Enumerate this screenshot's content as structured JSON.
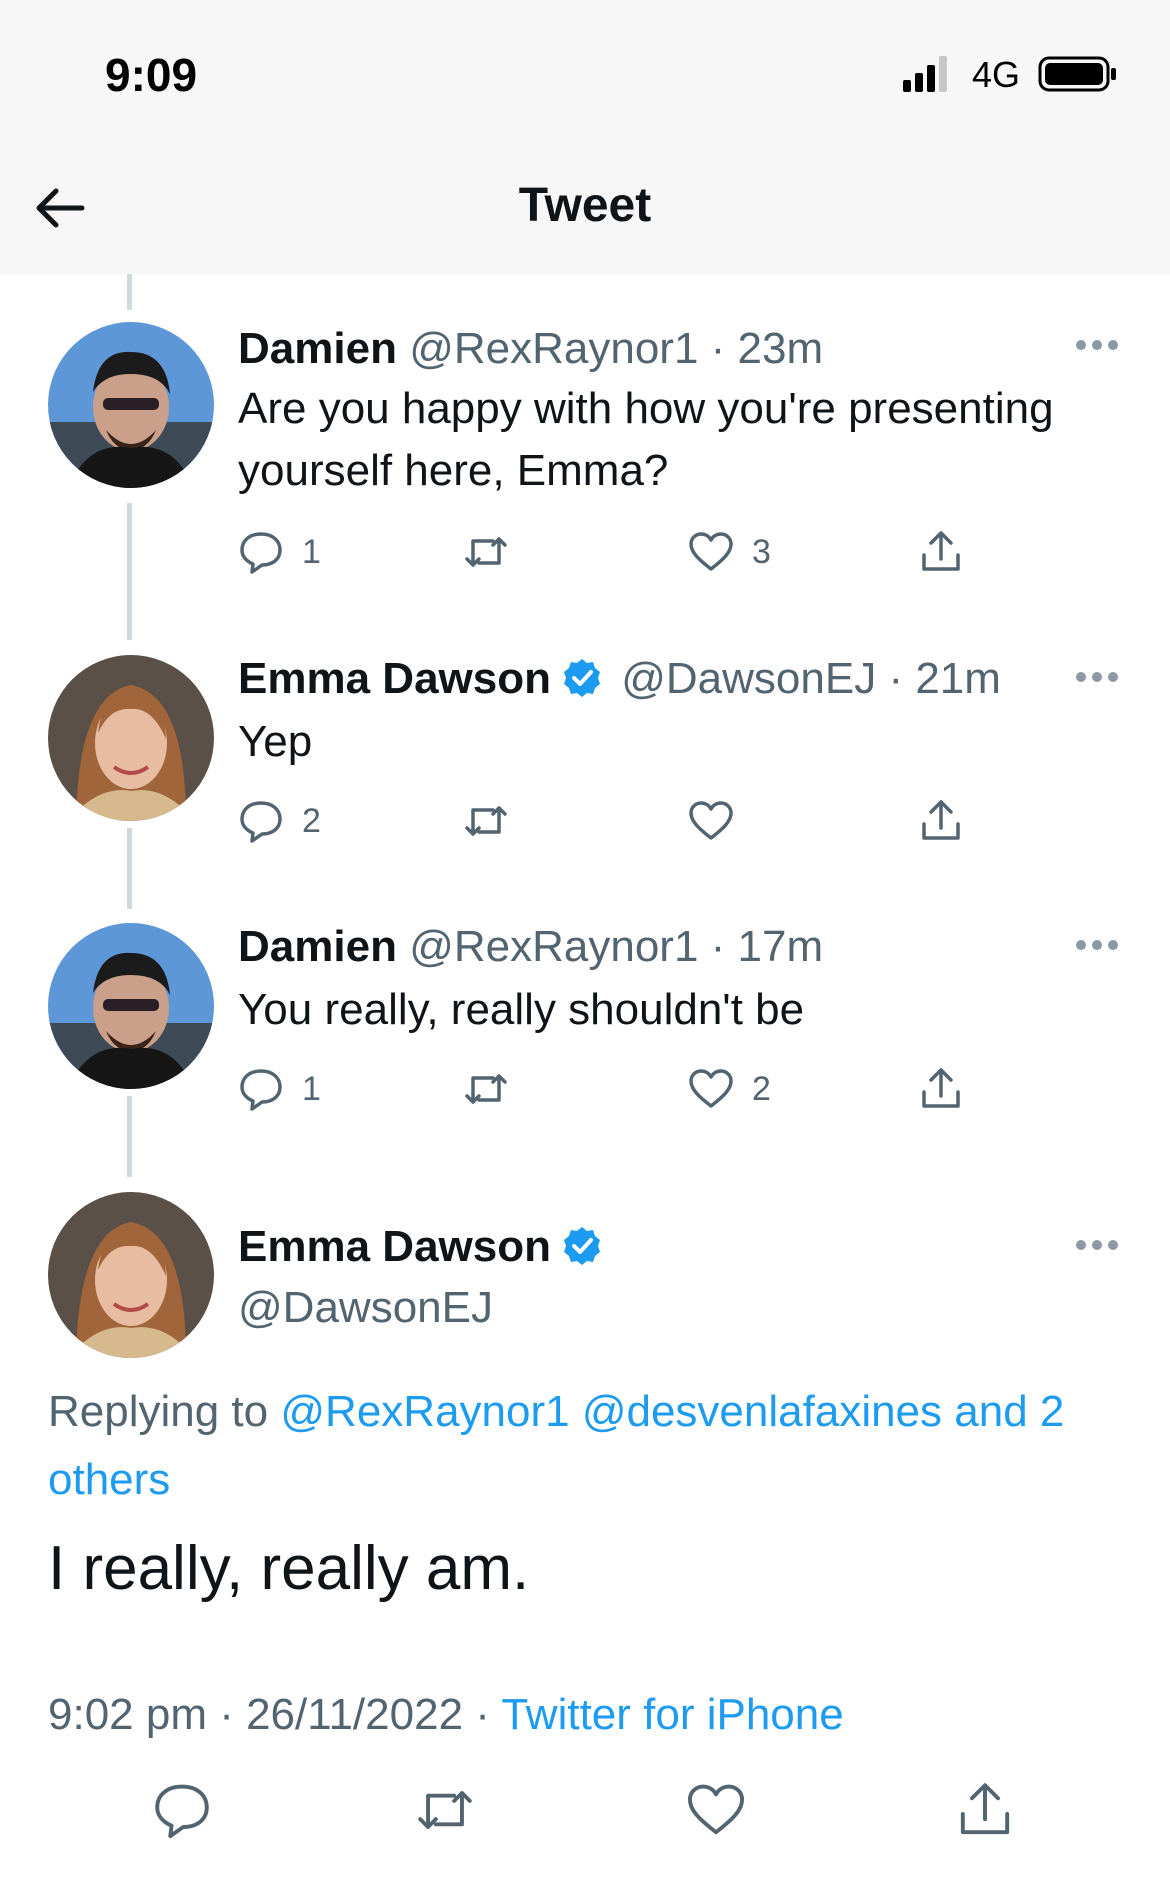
{
  "status_bar": {
    "time": "9:09",
    "network": "4G",
    "signal_icon": "signal-bars-icon",
    "battery_icon": "battery-icon"
  },
  "header": {
    "title": "Tweet",
    "back_icon": "arrow-left-icon"
  },
  "thread": [
    {
      "name": "Damien",
      "handle": "@RexRaynor1",
      "time": "· 23m",
      "verified": false,
      "text": "Are you happy with how you're presenting yourself here, Emma?",
      "reply_count": "1",
      "retweet_count": "",
      "like_count": "3"
    },
    {
      "name": "Emma Dawson",
      "handle": "@DawsonEJ",
      "time": "· 21m",
      "verified": true,
      "text": "Yep",
      "reply_count": "2",
      "retweet_count": "",
      "like_count": ""
    },
    {
      "name": "Damien",
      "handle": "@RexRaynor1",
      "time": "· 17m",
      "verified": false,
      "text": "You really, really shouldn't be",
      "reply_count": "1",
      "retweet_count": "",
      "like_count": "2"
    }
  ],
  "main_tweet": {
    "name": "Emma Dawson",
    "handle": "@DawsonEJ",
    "verified": true,
    "replying_prefix": "Replying to",
    "replying_links": "@RexRaynor1 @desvenlafaxines and 2 others",
    "text": "I really, really am.",
    "timestamp": "9:02 pm · 26/11/2022 · ",
    "source": "Twitter for iPhone"
  },
  "colors": {
    "accent": "#1d9bf0",
    "muted": "#536471",
    "text": "#0f1419",
    "thread_line": "#cfd9de"
  }
}
